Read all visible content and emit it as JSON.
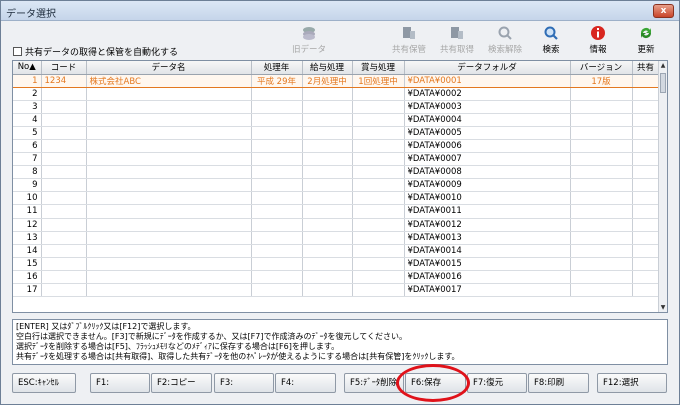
{
  "window": {
    "title": "データ選択",
    "close": "x"
  },
  "option": {
    "auto_label": "共有データの取得と保管を自動化する"
  },
  "toolbar": {
    "old_data": "旧データ",
    "share_save": "共有保管",
    "share_get": "共有取得",
    "search_clear": "検索解除",
    "search": "検索",
    "info": "情報",
    "update": "更新"
  },
  "table": {
    "headers": [
      "No▲",
      "コード",
      "データ名",
      "処理年",
      "給与処理",
      "賞与処理",
      "データフォルダ",
      "バージョン",
      "共有"
    ],
    "selected": {
      "no": "1",
      "code": "1234",
      "name": "株式会社ABC",
      "year": "平成 29年",
      "salary": "2月処理中",
      "bonus": "1回処理中",
      "folder": "¥DATA¥0001",
      "version": "17版"
    },
    "rows": [
      {
        "no": "2",
        "folder": "¥DATA¥0002"
      },
      {
        "no": "3",
        "folder": "¥DATA¥0003"
      },
      {
        "no": "4",
        "folder": "¥DATA¥0004"
      },
      {
        "no": "5",
        "folder": "¥DATA¥0005"
      },
      {
        "no": "6",
        "folder": "¥DATA¥0006"
      },
      {
        "no": "7",
        "folder": "¥DATA¥0007"
      },
      {
        "no": "8",
        "folder": "¥DATA¥0008"
      },
      {
        "no": "9",
        "folder": "¥DATA¥0009"
      },
      {
        "no": "10",
        "folder": "¥DATA¥0010"
      },
      {
        "no": "11",
        "folder": "¥DATA¥0011"
      },
      {
        "no": "12",
        "folder": "¥DATA¥0012"
      },
      {
        "no": "13",
        "folder": "¥DATA¥0013"
      },
      {
        "no": "14",
        "folder": "¥DATA¥0014"
      },
      {
        "no": "15",
        "folder": "¥DATA¥0015"
      },
      {
        "no": "16",
        "folder": "¥DATA¥0016"
      },
      {
        "no": "17",
        "folder": "¥DATA¥0017"
      }
    ]
  },
  "message": [
    "[ENTER] 又はﾀﾞﾌﾞﾙｸﾘｯｸ又は[F12]で選択します。",
    "空白行は選択できません。[F3]で新規にﾃﾞｰﾀを作成するか、又は[F7]で作成済みのﾃﾞｰﾀを復元してください。",
    "選択ﾃﾞｰﾀを削除する場合は[F5]、ﾌﾗｯｼｭﾒﾓﾘなどのﾒﾃﾞｨｱに保存する場合は[F6]を押します。",
    "共有ﾃﾞｰﾀを処理する場合は[共有取得]、取得した共有ﾃﾞｰﾀを他のｵﾍﾟﾚｰﾀが使えるようにする場合は[共有保管]をｸﾘｯｸします。"
  ],
  "fkeys": {
    "esc": "ESC:ｷｬﾝｾﾙ",
    "f1": "F1:",
    "f2": "F2:コピー",
    "f3": "F3:",
    "f4": "F4:",
    "f5": "F5:ﾃﾞｰﾀ削除",
    "f6": "F6:保存",
    "f7": "F7:復元",
    "f8": "F8:印刷",
    "f12": "F12:選択"
  },
  "colors": {
    "selected_row": "#e37820",
    "highlight_ring": "#e0121a"
  }
}
